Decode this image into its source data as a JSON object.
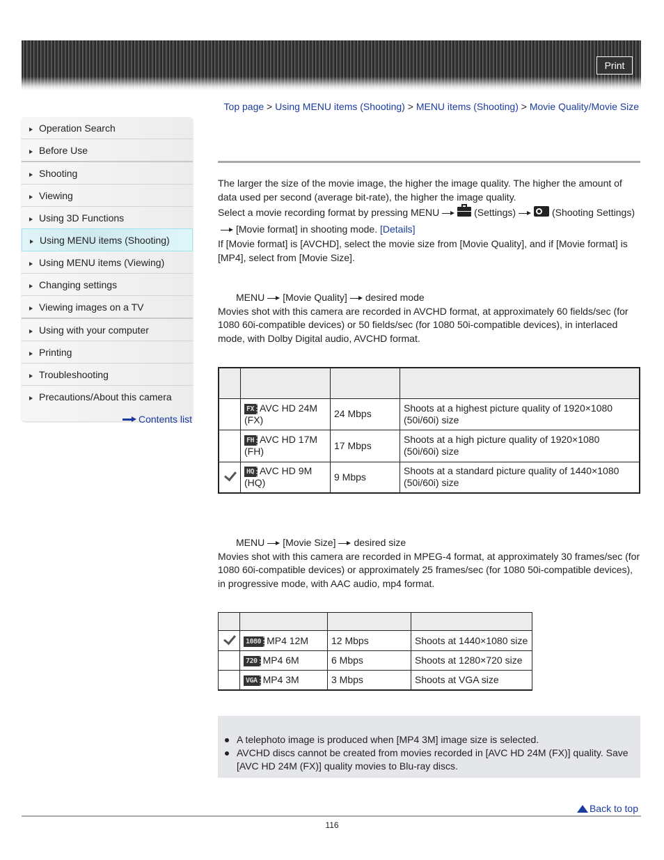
{
  "header": {
    "print_label": "Print"
  },
  "sidebar": {
    "items": [
      {
        "label": "Operation Search"
      },
      {
        "label": "Before Use"
      },
      {
        "label": "Shooting"
      },
      {
        "label": "Viewing"
      },
      {
        "label": "Using 3D Functions"
      },
      {
        "label": "Using MENU items (Shooting)",
        "active": true
      },
      {
        "label": "Using MENU items (Viewing)"
      },
      {
        "label": "Changing settings"
      },
      {
        "label": "Viewing images on a TV"
      },
      {
        "label": "Using with your computer"
      },
      {
        "label": "Printing"
      },
      {
        "label": "Troubleshooting"
      },
      {
        "label": "Precautions/About this camera"
      }
    ],
    "contents_list": "Contents list"
  },
  "breadcrumb": {
    "items": [
      "Top page",
      "Using MENU items (Shooting)",
      "MENU items (Shooting)",
      "Movie Quality/Movie Size"
    ],
    "separator": " > "
  },
  "intro": {
    "p1": "The larger the size of the movie image, the higher the image quality. The higher the amount of data used per second (average bit-rate), the higher the image quality.",
    "p2_a": "Select a movie recording format by pressing MENU",
    "p2_settings": "(Settings)",
    "p2_shooting": "(Shooting Settings)",
    "p2_b": "[Movie format] in shooting mode.",
    "p2_link": "[Details]",
    "p3": "If [Movie format] is [AVCHD], select the movie size from [Movie Quality], and if [Movie format] is [MP4], select from [Movie Size]."
  },
  "movie_quality": {
    "steps": [
      "MENU",
      "[Movie Quality]",
      "desired mode"
    ],
    "description": "Movies shot with this camera are recorded in AVCHD format, at approximately 60 fields/sec (for 1080 60i-compatible devices) or 50 fields/sec (for 1080 50i-compatible devices), in interlaced mode, with Dolby Digital audio, AVCHD format.",
    "rows": [
      {
        "icon": "FX",
        "name": "AVC HD 24M (FX)",
        "bitrate": "24 Mbps",
        "desc": "Shoots at a highest picture quality of 1920×1080 (50i/60i) size",
        "selected": false
      },
      {
        "icon": "FH",
        "name": "AVC HD 17M (FH)",
        "bitrate": "17 Mbps",
        "desc": "Shoots at a high picture quality of 1920×1080 (50i/60i) size",
        "selected": false
      },
      {
        "icon": "HQ",
        "name": "AVC HD 9M (HQ)",
        "bitrate": "9 Mbps",
        "desc": "Shoots at a standard picture quality of 1440×1080 (50i/60i) size",
        "selected": true
      }
    ]
  },
  "movie_size": {
    "steps": [
      "MENU",
      "[Movie Size]",
      "desired size"
    ],
    "description": "Movies shot with this camera are recorded in MPEG-4 format, at approximately 30 frames/sec (for 1080 60i-compatible devices) or approximately 25 frames/sec (for 1080 50i-compatible devices), in progressive mode, with AAC audio, mp4 format.",
    "rows": [
      {
        "icon": "1080",
        "name": "MP4 12M",
        "bitrate": "12 Mbps",
        "desc": "Shoots at 1440×1080 size",
        "selected": true
      },
      {
        "icon": "720",
        "name": "MP4 6M",
        "bitrate": "6 Mbps",
        "desc": "Shoots at 1280×720 size",
        "selected": false
      },
      {
        "icon": "VGA",
        "name": "MP4 3M",
        "bitrate": "3 Mbps",
        "desc": "Shoots at VGA size",
        "selected": false
      }
    ]
  },
  "notes": [
    "A telephoto image is produced when [MP4 3M] image size is selected.",
    "AVCHD discs cannot be created from movies recorded in [AVC HD 24M (FX)] quality. Save [AVC HD 24M (FX)] quality movies to Blu-ray discs."
  ],
  "footer": {
    "back_to_top": "Back to top",
    "page_number": "116"
  },
  "colors": {
    "link": "#1a3c9e",
    "active_item_bg": "#dff6fa",
    "note_bg": "#e4e6ea"
  }
}
